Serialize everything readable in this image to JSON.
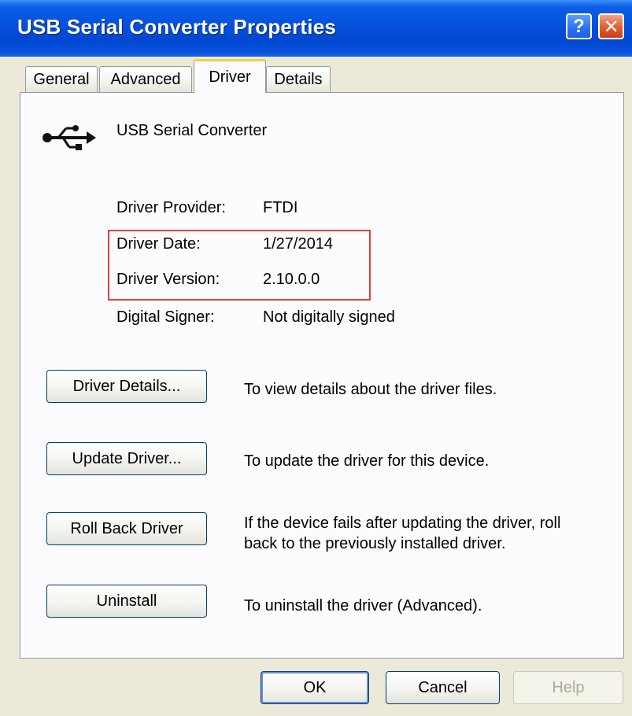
{
  "window": {
    "title": "USB Serial Converter Properties",
    "help_glyph": "?",
    "close_glyph": "✕"
  },
  "tabs": [
    {
      "label": "General"
    },
    {
      "label": "Advanced"
    },
    {
      "label": "Driver",
      "active": true
    },
    {
      "label": "Details"
    }
  ],
  "device": {
    "icon": "usb-icon",
    "name": "USB Serial Converter"
  },
  "properties": [
    {
      "label": "Driver Provider:",
      "value": "FTDI"
    },
    {
      "label": "Driver Date:",
      "value": "1/27/2014"
    },
    {
      "label": "Driver Version:",
      "value": "2.10.0.0"
    },
    {
      "label": "Digital Signer:",
      "value": "Not digitally signed"
    }
  ],
  "actions": [
    {
      "button": "Driver Details...",
      "description": "To view details about the driver files."
    },
    {
      "button": "Update Driver...",
      "description": "To update the driver for this device."
    },
    {
      "button": "Roll Back Driver",
      "description_line1": "If the device fails after updating the driver, roll",
      "description_line2": "back to the previously installed driver."
    },
    {
      "button": "Uninstall",
      "description": "To uninstall the driver (Advanced)."
    }
  ],
  "footer": {
    "ok": "OK",
    "cancel": "Cancel",
    "help": "Help"
  },
  "colors": {
    "titlebar": "#0550dc",
    "highlight_box": "#e04040",
    "active_tab_accent": "#ffc83c"
  }
}
